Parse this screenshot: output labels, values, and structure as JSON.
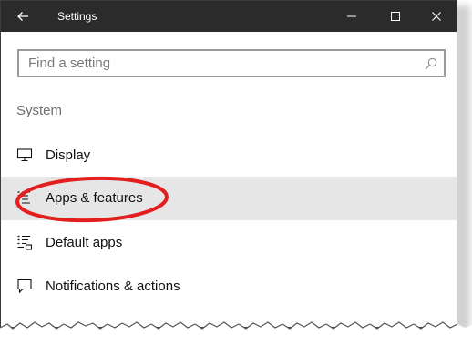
{
  "window": {
    "title": "Settings",
    "back_icon": "back-arrow-icon",
    "controls": [
      "minimize-icon",
      "maximize-icon",
      "close-icon"
    ],
    "titlebar_color": "#2b2b2b"
  },
  "search": {
    "placeholder": "Find a setting",
    "value": "",
    "icon": "search-icon"
  },
  "section": {
    "title": "System"
  },
  "nav": {
    "items": [
      {
        "label": "Display",
        "icon": "display-icon",
        "selected": false
      },
      {
        "label": "Apps & features",
        "icon": "apps-features-icon",
        "selected": true
      },
      {
        "label": "Default apps",
        "icon": "default-apps-icon",
        "selected": false
      },
      {
        "label": "Notifications & actions",
        "icon": "notifications-icon",
        "selected": false
      }
    ],
    "selected_bg": "#e6e6e6"
  },
  "annotation": {
    "highlight_color": "#e31e1e"
  }
}
